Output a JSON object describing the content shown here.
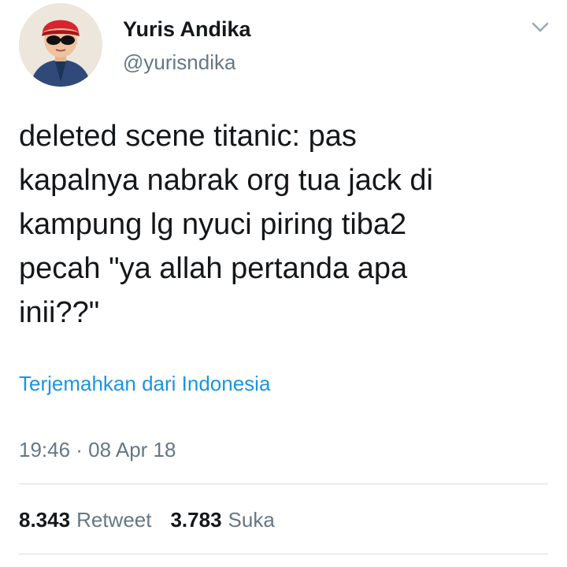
{
  "author": {
    "display_name": "Yuris Andika",
    "handle": "@yurisndika"
  },
  "tweet": {
    "text": "deleted scene titanic: pas\nkapalnya nabrak org tua jack di\nkampung lg nyuci piring tiba2\npecah \"ya allah pertanda apa\ninii??\"",
    "translate_label": "Terjemahkan dari Indonesia",
    "timestamp": "19:46 · 08 Apr 18"
  },
  "stats": {
    "retweets_count": "8.343",
    "retweets_label": "Retweet",
    "likes_count": "3.783",
    "likes_label": "Suka"
  },
  "icons": {
    "caret": "chevron-down-icon"
  },
  "colors": {
    "link": "#1b95e0",
    "secondary_text": "#657786",
    "primary_text": "#14171a",
    "divider": "#d8dee2"
  }
}
